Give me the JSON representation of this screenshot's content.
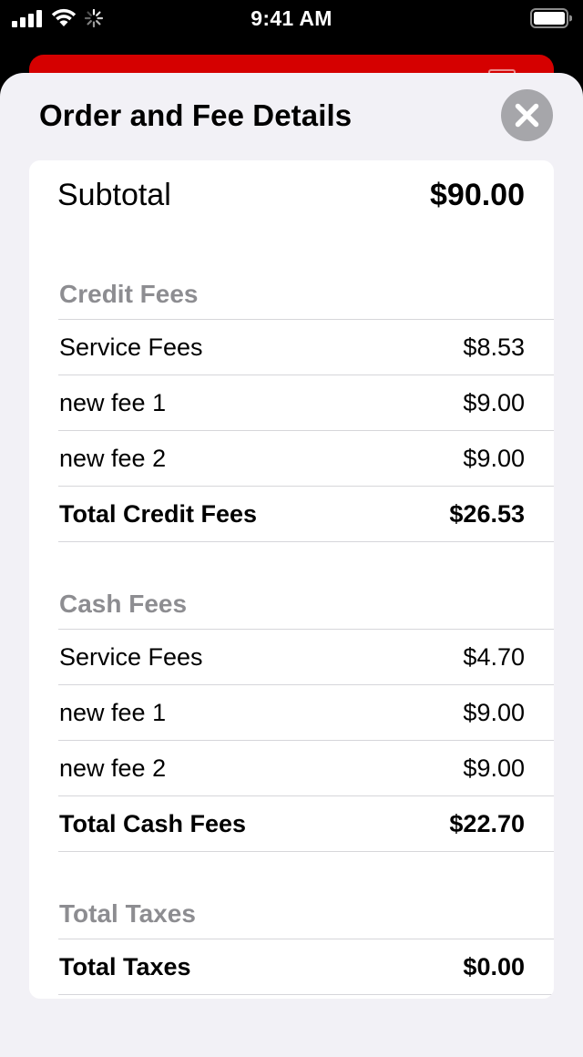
{
  "status_bar": {
    "time": "9:41 AM"
  },
  "sheet": {
    "title": "Order and Fee Details"
  },
  "subtotal": {
    "label": "Subtotal",
    "amount": "$90.00"
  },
  "credit_fees": {
    "header": "Credit Fees",
    "rows": [
      {
        "label": "Service Fees",
        "amount": "$8.53"
      },
      {
        "label": "new fee 1",
        "amount": "$9.00"
      },
      {
        "label": "new fee 2",
        "amount": "$9.00"
      }
    ],
    "total": {
      "label": "Total Credit Fees",
      "amount": "$26.53"
    }
  },
  "cash_fees": {
    "header": "Cash Fees",
    "rows": [
      {
        "label": "Service Fees",
        "amount": "$4.70"
      },
      {
        "label": "new fee 1",
        "amount": "$9.00"
      },
      {
        "label": "new fee 2",
        "amount": "$9.00"
      }
    ],
    "total": {
      "label": "Total Cash Fees",
      "amount": "$22.70"
    }
  },
  "taxes": {
    "header": "Total Taxes",
    "total": {
      "label": "Total Taxes",
      "amount": "$0.00"
    }
  },
  "icons": {
    "status_left": [
      "cellular-signal-icon",
      "wifi-icon",
      "activity-spinner-icon"
    ],
    "status_right": "battery-icon",
    "close": "close-icon"
  },
  "colors": {
    "screen_background": "#000000",
    "accent_red": "#d50000",
    "sheet_background": "#f2f1f6",
    "card_background": "#ffffff",
    "section_header": "#8d8d91",
    "close_button": "#a6a6aa",
    "divider": "#d6d6da"
  }
}
